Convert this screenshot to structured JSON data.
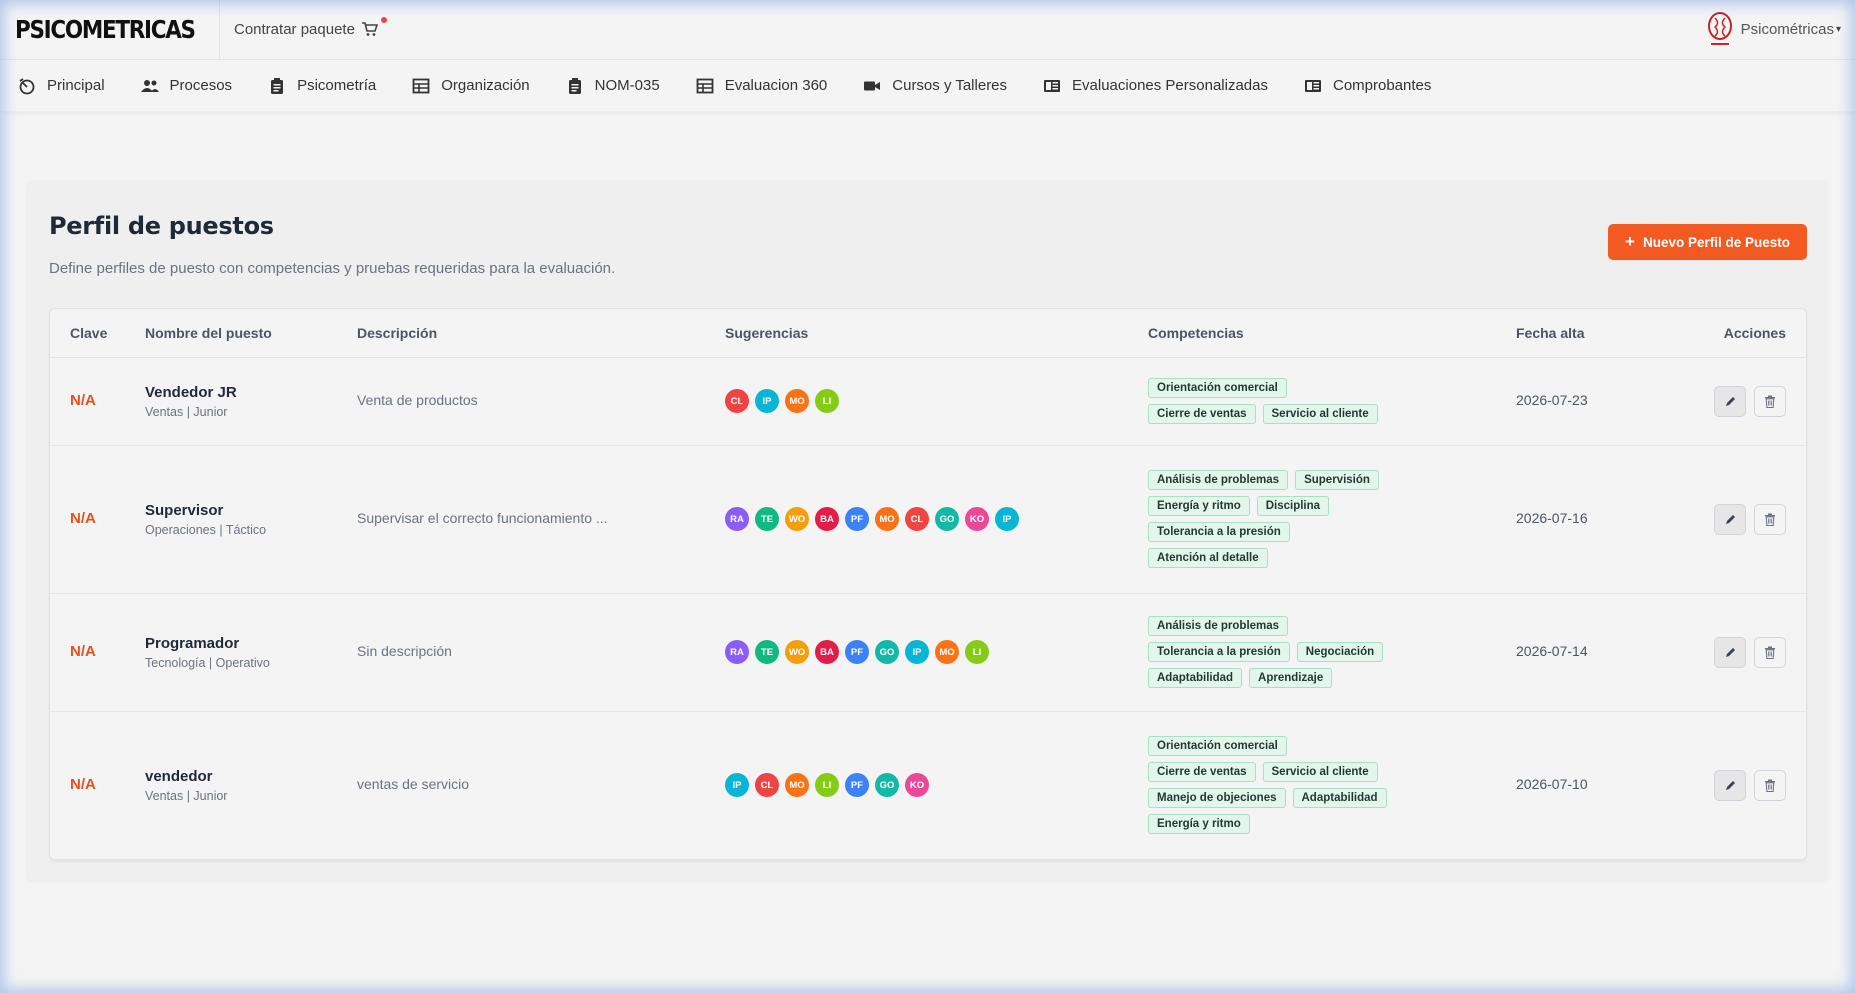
{
  "brand": {
    "name": "PSICOMETRICAS"
  },
  "header": {
    "cart_label": "Contratar paquete",
    "user_label": "Psicométricas"
  },
  "nav": [
    {
      "label": "Principal",
      "icon": "dashboard-icon"
    },
    {
      "label": "Procesos",
      "icon": "people-icon"
    },
    {
      "label": "Psicometría",
      "icon": "clipboard-icon"
    },
    {
      "label": "Organización",
      "icon": "table-icon"
    },
    {
      "label": "NOM-035",
      "icon": "clipboard-icon"
    },
    {
      "label": "Evaluacion 360",
      "icon": "table-icon"
    },
    {
      "label": "Cursos y Talleres",
      "icon": "video-icon"
    },
    {
      "label": "Evaluaciones Personalizadas",
      "icon": "book-icon"
    },
    {
      "label": "Comprobantes",
      "icon": "book-icon"
    }
  ],
  "page": {
    "title": "Perfil de puestos",
    "subtitle": "Define perfiles de puesto con competencias y pruebas requeridas para la evaluación.",
    "new_button": "Nuevo Perfil de Puesto"
  },
  "table": {
    "headers": {
      "clave": "Clave",
      "nombre": "Nombre del puesto",
      "descripcion": "Descripción",
      "sugerencias": "Sugerencias",
      "competencias": "Competencias",
      "fecha": "Fecha alta",
      "acciones": "Acciones"
    },
    "rows": [
      {
        "clave": "N/A",
        "nombre": "Vendedor JR",
        "meta": "Ventas | Junior",
        "descripcion": "Venta de productos",
        "sugerencias": [
          "CL",
          "IP",
          "MO",
          "LI"
        ],
        "competencias": [
          "Orientación comercial",
          "Cierre de ventas",
          "Servicio al cliente"
        ],
        "fecha": "2026-07-23"
      },
      {
        "clave": "N/A",
        "nombre": "Supervisor",
        "meta": "Operaciones | Táctico",
        "descripcion": "Supervisar el correcto funcionamiento ...",
        "sugerencias": [
          "RA",
          "TE",
          "WO",
          "BA",
          "PF",
          "MO",
          "CL",
          "GO",
          "KO",
          "IP"
        ],
        "competencias": [
          "Análisis de problemas",
          "Supervisión",
          "Energía y ritmo",
          "Disciplina",
          "Tolerancia a la presión",
          "Atención al detalle"
        ],
        "fecha": "2026-07-16"
      },
      {
        "clave": "N/A",
        "nombre": "Programador",
        "meta": "Tecnología | Operativo",
        "descripcion": "Sin descripción",
        "sugerencias": [
          "RA",
          "TE",
          "WO",
          "BA",
          "PF",
          "GO",
          "IP",
          "MO",
          "LI"
        ],
        "competencias": [
          "Análisis de problemas",
          "Tolerancia a la presión",
          "Negociación",
          "Adaptabilidad",
          "Aprendizaje"
        ],
        "fecha": "2026-07-14"
      },
      {
        "clave": "N/A",
        "nombre": "vendedor",
        "meta": "Ventas | Junior",
        "descripcion": "ventas de servicio",
        "sugerencias": [
          "IP",
          "CL",
          "MO",
          "LI",
          "PF",
          "GO",
          "KO"
        ],
        "competencias": [
          "Orientación comercial",
          "Cierre de ventas",
          "Servicio al cliente",
          "Manejo de objeciones",
          "Adaptabilidad",
          "Energía y ritmo"
        ],
        "fecha": "2026-07-10"
      }
    ]
  },
  "colors": {
    "accent": "#f25a22",
    "RA": "#8b5cf6",
    "TE": "#10b981",
    "WO": "#f59e0b",
    "BA": "#e11d48",
    "PF": "#3b82f6",
    "MO": "#f97316",
    "CL": "#ef4444",
    "GO": "#14b8a6",
    "KO": "#ec4899",
    "IP": "#06b6d4",
    "LI": "#84cc16"
  }
}
